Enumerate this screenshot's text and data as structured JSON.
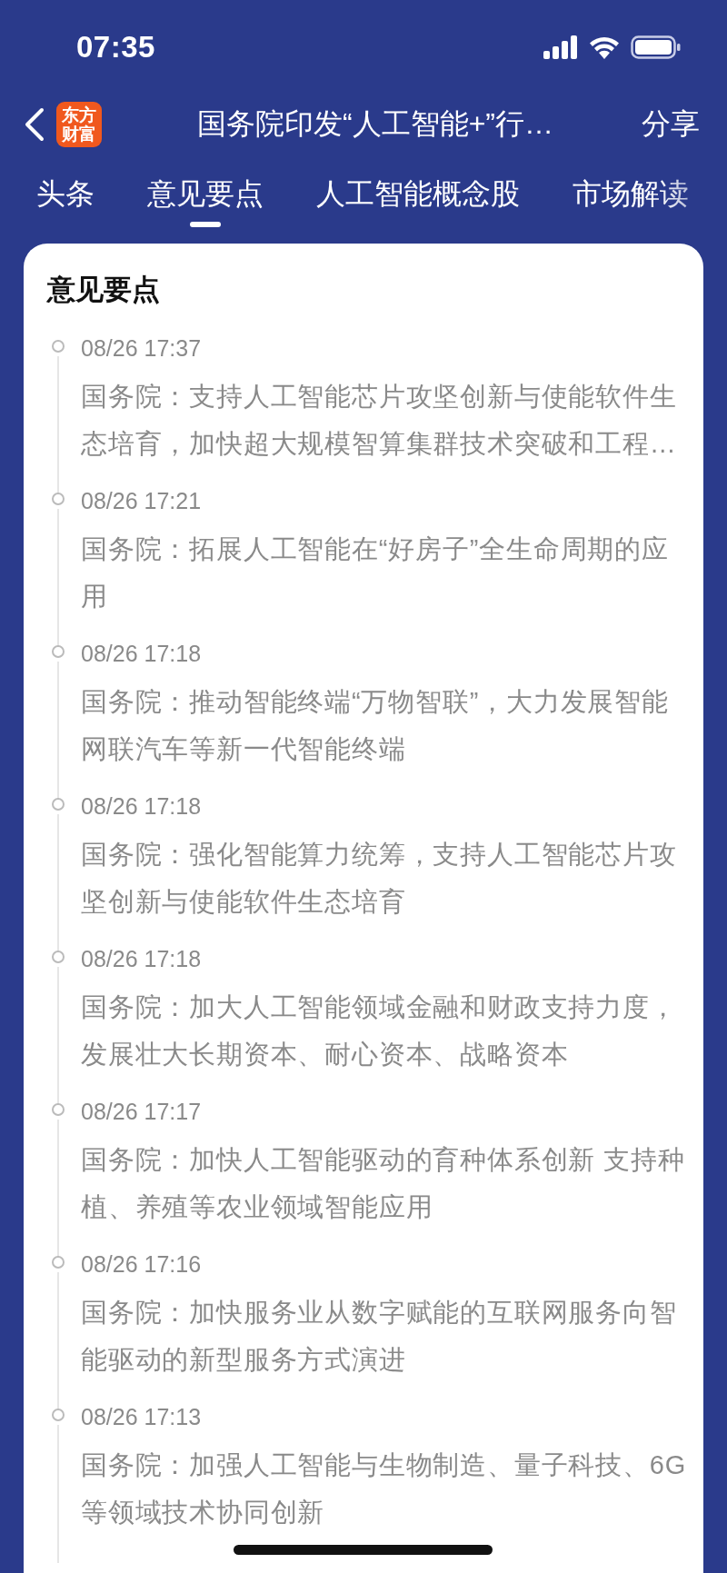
{
  "status_bar": {
    "time": "07:35"
  },
  "nav": {
    "logo": [
      "东方",
      "财富"
    ],
    "title": "国务院印发“人工智能+”行…",
    "share": "分享"
  },
  "tabs": [
    {
      "label": "头条",
      "selected": false
    },
    {
      "label": "意见要点",
      "selected": true
    },
    {
      "label": "人工智能概念股",
      "selected": false
    },
    {
      "label": "市场解读",
      "selected": false
    }
  ],
  "section": {
    "title": "意见要点",
    "items": [
      {
        "time": "08/26 17:37",
        "text": "国务院：支持人工智能芯片攻坚创新与使能软件生态培育，加快超大规模智算集群技术突破和工程…"
      },
      {
        "time": "08/26 17:21",
        "text": "国务院：拓展人工智能在“好房子”全生命周期的应用"
      },
      {
        "time": "08/26 17:18",
        "text": "国务院：推动智能终端“万物智联”，大力发展智能网联汽车等新一代智能终端"
      },
      {
        "time": "08/26 17:18",
        "text": "国务院：强化智能算力统筹，支持人工智能芯片攻坚创新与使能软件生态培育"
      },
      {
        "time": "08/26 17:18",
        "text": "国务院：加大人工智能领域金融和财政支持力度，发展壮大长期资本、耐心资本、战略资本"
      },
      {
        "time": "08/26 17:17",
        "text": "国务院：加快人工智能驱动的育种体系创新 支持种植、养殖等农业领域智能应用"
      },
      {
        "time": "08/26 17:16",
        "text": "国务院：加快服务业从数字赋能的互联网服务向智能驱动的新型服务方式演进"
      },
      {
        "time": "08/26 17:13",
        "text": "国务院：加强人工智能与生物制造、量子科技、6G等领域技术协同创新"
      }
    ]
  }
}
